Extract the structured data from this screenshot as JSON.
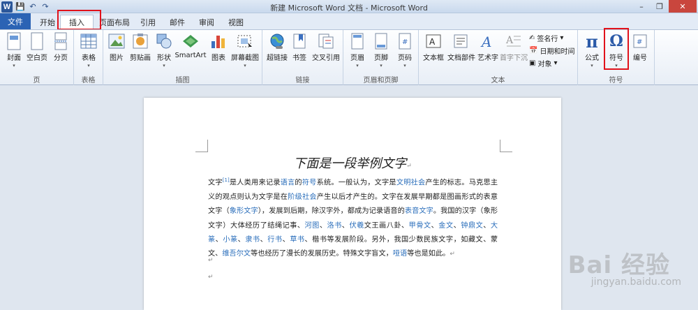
{
  "window": {
    "title": "新建 Microsoft Word 文档 - Microsoft Word",
    "app_letter": "W"
  },
  "qat": {
    "save": "💾",
    "undo": "↶",
    "redo": "↷"
  },
  "controls": {
    "minimize": "–",
    "restore": "❐",
    "close": "✕"
  },
  "tabs": [
    {
      "label": "文件"
    },
    {
      "label": "开始"
    },
    {
      "label": "插入"
    },
    {
      "label": "页面布局"
    },
    {
      "label": "引用"
    },
    {
      "label": "邮件"
    },
    {
      "label": "审阅"
    },
    {
      "label": "视图"
    }
  ],
  "ribbon": {
    "groups": {
      "pages": {
        "label": "页",
        "buttons": [
          "封面",
          "空白页",
          "分页"
        ]
      },
      "tables": {
        "label": "表格",
        "buttons": [
          "表格"
        ]
      },
      "illustrations": {
        "label": "插图",
        "buttons": [
          "图片",
          "剪贴画",
          "形状",
          "SmartArt",
          "图表",
          "屏幕截图"
        ]
      },
      "links": {
        "label": "链接",
        "buttons": [
          "超链接",
          "书签",
          "交叉引用"
        ]
      },
      "header_footer": {
        "label": "页眉和页脚",
        "buttons": [
          "页眉",
          "页脚",
          "页码"
        ]
      },
      "text": {
        "label": "文本",
        "buttons": [
          "文本框",
          "文档部件",
          "艺术字",
          "首字下沉"
        ],
        "small": [
          "签名行",
          "日期和时间",
          "对象"
        ]
      },
      "symbols": {
        "label": "符号",
        "buttons": [
          "公式",
          "符号",
          "编号"
        ]
      }
    }
  },
  "document": {
    "heading": "下面是一段举例文字",
    "para": {
      "p1": "文字",
      "ref": "[1]",
      "p2": "是人类用来记录",
      "l1": "语言",
      "p3": "的",
      "l2": "符号",
      "p4": "系统。一般认为，文字是",
      "l3": "文明社会",
      "p5": "产生的标志。马克思主义的观点则认为文字是在",
      "l4": "阶级社会",
      "p6": "产生以后才产生的。文字在发展早期都是图画形式的表意文字（",
      "l5": "象形文字",
      "p7": "），发展到后期，除汉字外，都成为记录语音的",
      "l6": "表音文字",
      "p8": "。我国的汉字（象形文字）大体经历了结绳记事、",
      "l7": "河图",
      "p9": "、",
      "l8": "洛书",
      "p10": "、",
      "l9": "伏羲",
      "p11": "文王画八卦、",
      "l10": "甲骨文",
      "p12": "、",
      "l11": "金文",
      "p13": "、",
      "l12": "钟鼎文",
      "p14": "、",
      "l13": "大篆",
      "p15": "、",
      "l14": "小篆",
      "p16": "、",
      "l15": "隶书",
      "p17": "、",
      "l16": "行书",
      "p18": "、",
      "l17": "草书",
      "p19": "、楷书等发展阶段。另外，我国少数民族文字，如藏文、蒙文、",
      "l18": "维吾尔文",
      "p20": "等也经历了漫长的发展历史。特殊文字盲文，",
      "l19": "哑语",
      "p21": "等也是如此。"
    },
    "para_mark": "↵"
  },
  "watermark": {
    "main": "Bai 经验",
    "sub": "jingyan.baidu.com"
  },
  "colors": {
    "accent": "#2b63b4",
    "link": "#2a6ebb",
    "highlight": "#e1121b"
  }
}
